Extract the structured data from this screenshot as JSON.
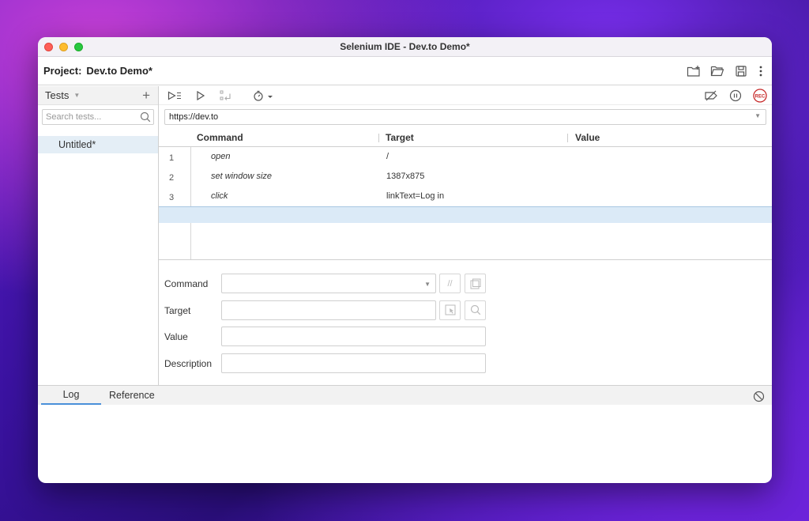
{
  "window": {
    "title": "Selenium IDE - Dev.to Demo*"
  },
  "project": {
    "label": "Project:",
    "name": "Dev.to Demo*"
  },
  "sidebar": {
    "header": "Tests",
    "search_placeholder": "Search tests...",
    "tests": [
      "Untitled*"
    ]
  },
  "url_bar": {
    "value": "https://dev.to"
  },
  "grid": {
    "columns": [
      "Command",
      "Target",
      "Value"
    ],
    "rows": [
      {
        "num": "1",
        "command": "open",
        "target": "/",
        "value": ""
      },
      {
        "num": "2",
        "command": "set window size",
        "target": "1387x875",
        "value": ""
      },
      {
        "num": "3",
        "command": "click",
        "target": "linkText=Log in",
        "value": ""
      }
    ]
  },
  "command_editor": {
    "command_label": "Command",
    "target_label": "Target",
    "value_label": "Value",
    "description_label": "Description"
  },
  "bottom_tabs": [
    "Log",
    "Reference"
  ],
  "icons": {
    "new_project": "new-folder-icon",
    "open_project": "open-folder-icon",
    "save_project": "save-icon",
    "more": "more-vertical-icon",
    "run_all": "run-all-tests-icon",
    "run_current": "play-icon",
    "step_over": "step-over-icon",
    "speed": "timer-icon",
    "disable_breakpoints": "disable-breakpoints-icon",
    "pause_on_exceptions": "pause-icon",
    "record": "record-icon",
    "clear_log": "clear-log-icon"
  },
  "colors": {
    "selected_row": "#dbeaf7",
    "active_tab_underline": "#4a90d9",
    "record": "#c62828"
  }
}
